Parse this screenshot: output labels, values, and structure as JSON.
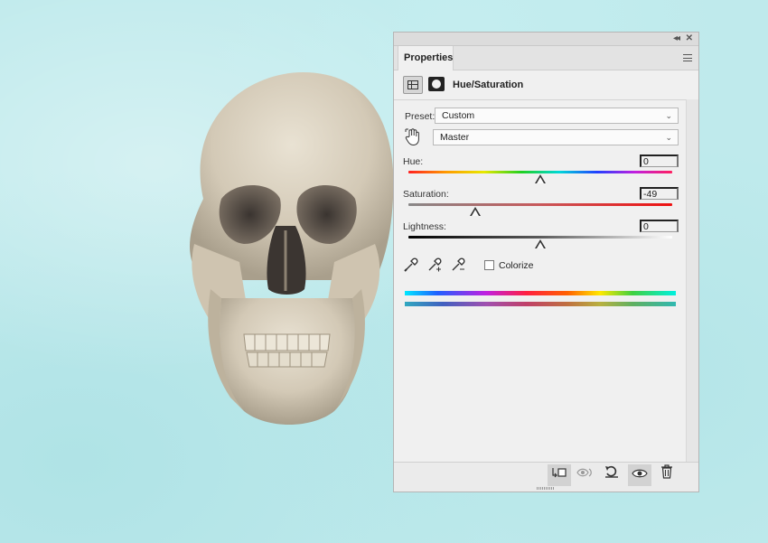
{
  "panel": {
    "tab_label": "Properties",
    "adjustment_title": "Hue/Saturation",
    "preset": {
      "label": "Preset:",
      "value": "Custom"
    },
    "channel": {
      "value": "Master"
    },
    "sliders": {
      "hue": {
        "label": "Hue:",
        "value": "0",
        "position": 0.5
      },
      "saturation": {
        "label": "Saturation:",
        "value": "-49",
        "position": 0.255
      },
      "lightness": {
        "label": "Lightness:",
        "value": "0",
        "position": 0.5
      }
    },
    "colorize": {
      "label": "Colorize",
      "checked": false
    }
  },
  "icons": {
    "collapse": "double-chevron-left-icon",
    "close": "close-icon",
    "panel_menu": "hamburger-menu-icon",
    "adjustment_type": "hue-saturation-layer-icon",
    "mask": "layer-mask-icon",
    "targeted_adjustment": "hand-drag-icon",
    "eyedroppers": [
      "eyedropper-icon",
      "eyedropper-add-icon",
      "eyedropper-subtract-icon"
    ],
    "bottom_bar": [
      "clip-to-layer-icon",
      "view-previous-state-icon",
      "reset-icon",
      "visibility-eye-icon",
      "trash-icon"
    ]
  },
  "colors": {
    "background": "#bfeaec",
    "panel": "#f0f0f0"
  }
}
